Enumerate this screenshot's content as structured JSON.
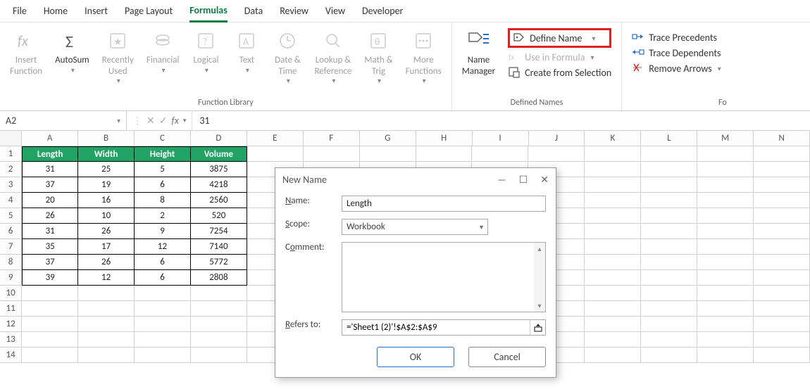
{
  "tabs": [
    "File",
    "Home",
    "Insert",
    "Page Layout",
    "Formulas",
    "Data",
    "Review",
    "View",
    "Developer"
  ],
  "active_tab": "Formulas",
  "ribbon": {
    "func_library_label": "Function Library",
    "defined_names_label": "Defined Names",
    "fo_label": "Fo",
    "insert_function": "Insert\nFunction",
    "autosum": "AutoSum",
    "recently_used": "Recently\nUsed",
    "financial": "Financial",
    "logical": "Logical",
    "text": "Text",
    "date_time": "Date &\nTime",
    "lookup_ref": "Lookup &\nReference",
    "math_trig": "Math &\nTrig",
    "more_functions": "More\nFunctions",
    "name_manager": "Name\nManager",
    "define_name": "Define Name",
    "use_in_formula": "Use in Formula",
    "create_from_selection": "Create from Selection",
    "trace_precedents": "Trace Precedents",
    "trace_dependents": "Trace Dependents",
    "remove_arrows": "Remove Arrows"
  },
  "name_box": "A2",
  "formula_value": "31",
  "columns": [
    "A",
    "B",
    "C",
    "D",
    "E",
    "F",
    "G",
    "H",
    "I",
    "J",
    "K",
    "L",
    "M",
    "N"
  ],
  "row_numbers": [
    "1",
    "2",
    "3",
    "4",
    "5",
    "6",
    "7",
    "8",
    "9",
    "10",
    "11",
    "12",
    "13",
    "14"
  ],
  "table": {
    "headers": [
      "Length",
      "Width",
      "Height",
      "Volume"
    ],
    "rows": [
      [
        "31",
        "25",
        "5",
        "3875"
      ],
      [
        "37",
        "19",
        "6",
        "4218"
      ],
      [
        "20",
        "16",
        "8",
        "2560"
      ],
      [
        "26",
        "10",
        "2",
        "520"
      ],
      [
        "31",
        "26",
        "9",
        "7254"
      ],
      [
        "35",
        "17",
        "12",
        "7140"
      ],
      [
        "37",
        "26",
        "6",
        "5772"
      ],
      [
        "39",
        "12",
        "6",
        "2808"
      ]
    ]
  },
  "dialog": {
    "title": "New Name",
    "name_label": "Name:",
    "name_value": "Length",
    "scope_label": "Scope:",
    "scope_value": "Workbook",
    "comment_label": "Comment:",
    "refers_label": "Refers to:",
    "refers_value": "='Sheet1 (2)'!$A$2:$A$9",
    "ok": "OK",
    "cancel": "Cancel"
  }
}
